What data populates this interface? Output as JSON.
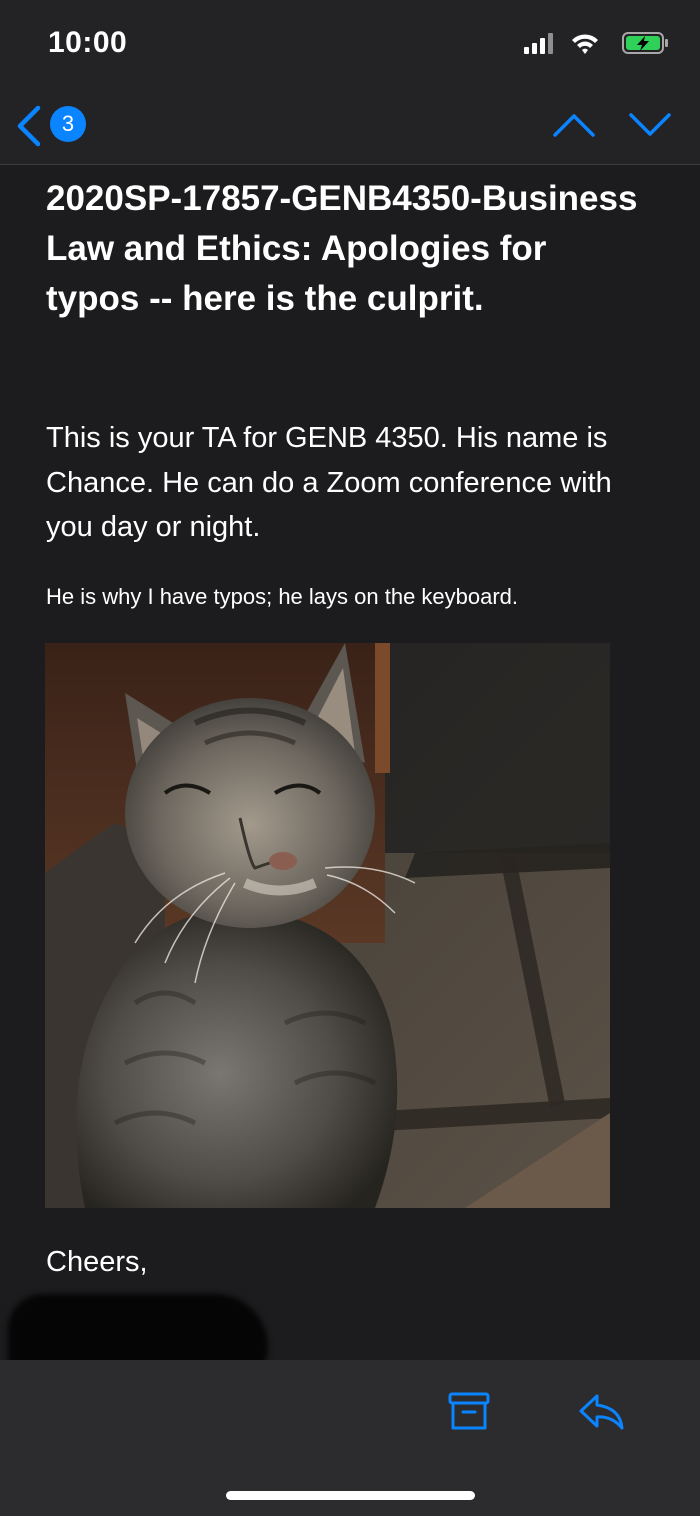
{
  "status_bar": {
    "time": "10:00",
    "icons": [
      "cellular-signal-icon",
      "wifi-icon",
      "battery-charging-icon"
    ],
    "battery_color": "#30d158"
  },
  "nav": {
    "back_icon": "chevron-left-icon",
    "unread_count": "3",
    "prev_icon": "chevron-up-icon",
    "next_icon": "chevron-down-icon",
    "accent_color": "#0a84ff"
  },
  "message": {
    "subject": "2020SP-17857-GENB4350-Business Law and Ethics: Apologies for typos -- here is the culprit.",
    "paragraph_1": "This is your TA for GENB 4350. His name is Chance. He can do a Zoom conference with you day or night.",
    "paragraph_2": "He is why I have typos; he lays on the keyboard.",
    "signoff": "Cheers,"
  },
  "toolbar": {
    "archive_icon": "archive-box-icon",
    "reply_icon": "reply-icon"
  }
}
